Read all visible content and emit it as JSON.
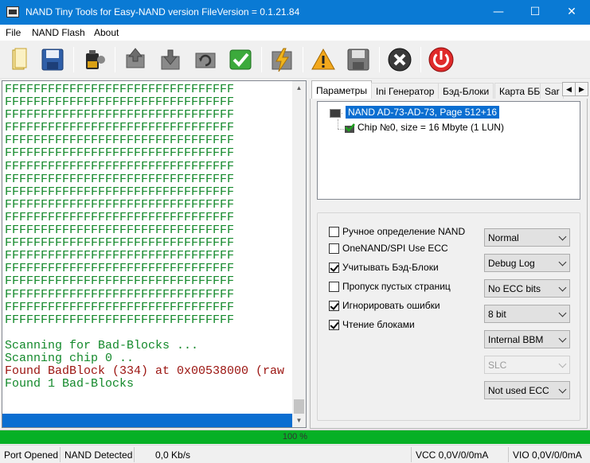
{
  "window": {
    "title": "NAND Tiny Tools for Easy-NAND version FileVersion = 0.1.21.84",
    "minimize": "—",
    "maximize": "☐",
    "close": "✕"
  },
  "menu": [
    {
      "label": "File",
      "key": "F"
    },
    {
      "label": "NAND Flash",
      "key": "N"
    },
    {
      "label": "About",
      "key": "A"
    }
  ],
  "toolbar": {
    "icons": [
      "open-file-icon",
      "save-disk-icon",
      "battery-power-icon",
      "read-chip-icon",
      "download-icon",
      "refresh-cycle-icon",
      "verify-check-icon",
      "lightning-write-icon",
      "warning-icon",
      "save-dump-icon",
      "stop-cross-icon",
      "power-icon"
    ]
  },
  "console": {
    "fill_line": "FFFFFFFFFFFFFFFFFFFFFFFFFFFFFFFF",
    "fill_count": 19,
    "messages": [
      {
        "text": "Scanning for Bad-Blocks ...",
        "color": "green"
      },
      {
        "text": "Scanning chip 0 ..",
        "color": "green"
      },
      {
        "text": "Found BadBlock (334) at 0x00538000 (raw",
        "color": "red"
      },
      {
        "text": "Found 1 Bad-Blocks",
        "color": "green"
      }
    ]
  },
  "tabs": [
    "Параметры",
    "Ini Генератор",
    "Бэд-Блоки",
    "Карта ББ",
    "Sar"
  ],
  "tab_arrows": {
    "left": "◀",
    "right": "▶"
  },
  "tree": {
    "root": "NAND AD-73-AD-73, Page 512+16",
    "child": "Chip №0, size = 16 Mbyte (1 LUN)"
  },
  "options": {
    "checkboxes": [
      {
        "label": "Ручное определение NAND",
        "checked": false
      },
      {
        "label": "OneNAND/SPI Use ECC",
        "checked": false
      },
      {
        "label": "Учитывать Бэд-Блоки",
        "checked": true
      },
      {
        "label": "Пропуск пустых страниц",
        "checked": false
      },
      {
        "label": "Игнорировать ошибки",
        "checked": true
      },
      {
        "label": "Чтение блоками",
        "checked": true
      }
    ],
    "selects": [
      {
        "value": "Normal",
        "enabled": true
      },
      {
        "value": "Debug Log",
        "enabled": true
      },
      {
        "value": "No ECC bits",
        "enabled": true
      },
      {
        "value": "8 bit",
        "enabled": true
      },
      {
        "value": "Internal BBM",
        "enabled": true
      },
      {
        "value": "SLC",
        "enabled": false
      },
      {
        "value": "Not used ECC",
        "enabled": true
      }
    ]
  },
  "progress": {
    "label": "100 %",
    "value": 100,
    "color": "#06b025"
  },
  "status": {
    "port": "Port Opened",
    "nand": "NAND Detected",
    "speed": "0,0 Kb/s",
    "vcc": "VCC 0,0V/0/0mA",
    "vio": "VIO 0,0V/0/0mA"
  }
}
